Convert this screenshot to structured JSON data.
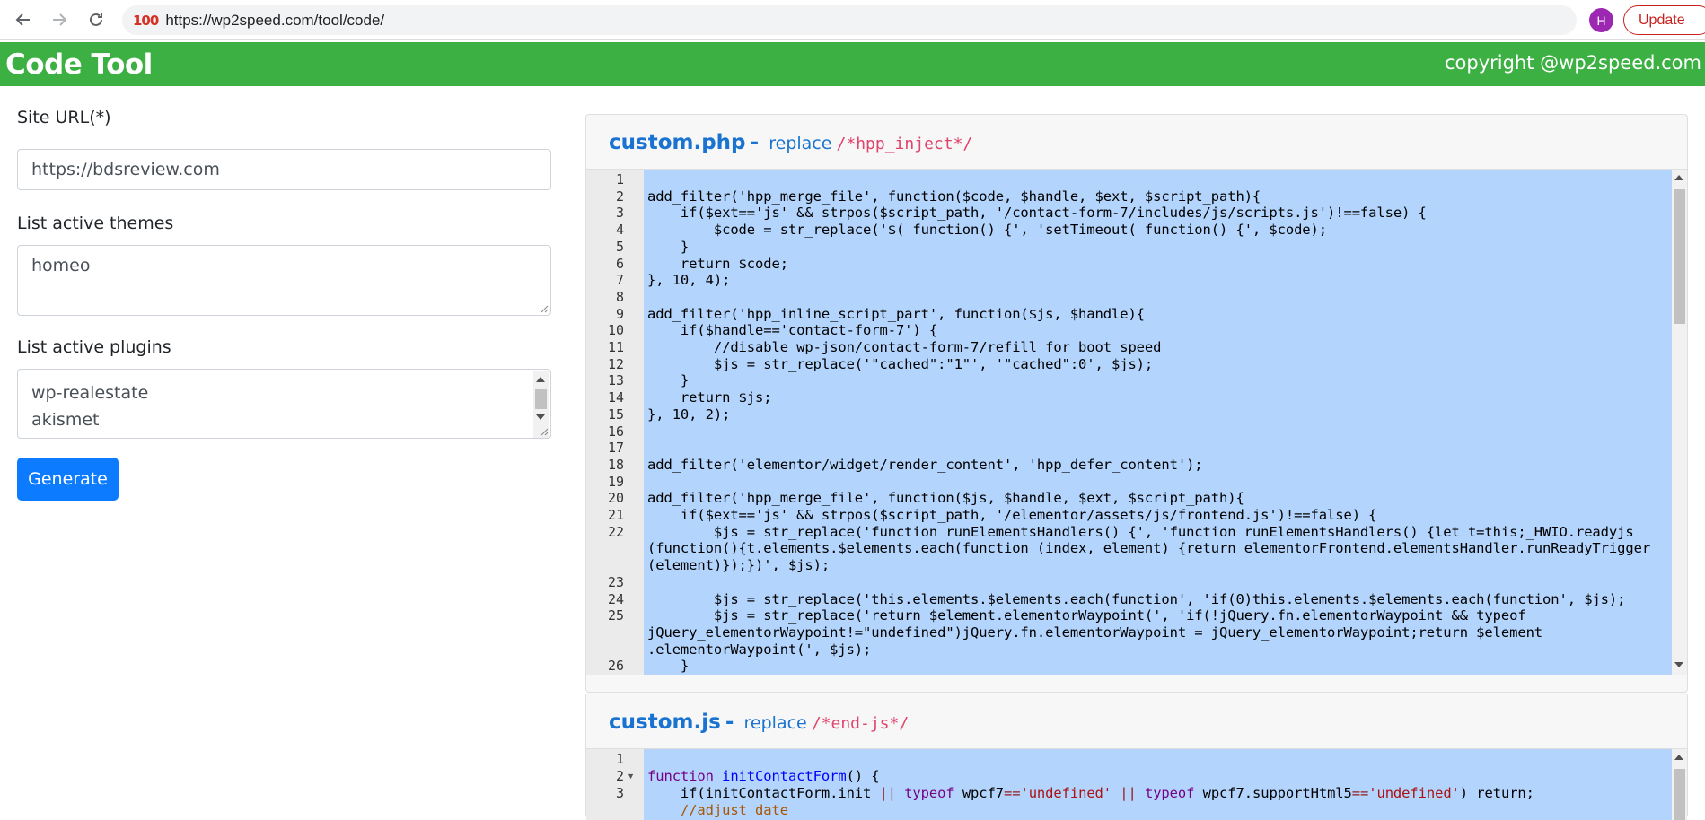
{
  "browser": {
    "url": "https://wp2speed.com/tool/code/",
    "profile_initial": "H",
    "update_label": "Update"
  },
  "header": {
    "title": "Code Tool",
    "copyright": "copyright @wp2speed.com"
  },
  "form": {
    "site_url_label": "Site URL(*)",
    "site_url_value": "https://bdsreview.com",
    "themes_label": "List active themes",
    "themes_value": "homeo",
    "plugins_label": "List active plugins",
    "plugins_line1": "wp-realestate",
    "plugins_line2": "akismet",
    "generate_label": "Generate"
  },
  "php_card": {
    "filename": "custom.php",
    "dash": "-",
    "replace_label": "replace",
    "marker": "/*hpp_inject*/",
    "line_numbers": [
      "1",
      "2",
      "3",
      "4",
      "5",
      "6",
      "7",
      "8",
      "9",
      "10",
      "11",
      "12",
      "13",
      "14",
      "15",
      "16",
      "17",
      "18",
      "19",
      "20",
      "21",
      "22",
      "23",
      "24",
      "25",
      "26"
    ],
    "lines": [
      "",
      "add_filter('hpp_merge_file', function($code, $handle, $ext, $script_path){",
      "    if($ext=='js' && strpos($script_path, '/contact-form-7/includes/js/scripts.js')!==false) {",
      "        $code = str_replace('$( function() {', 'setTimeout( function() {', $code);",
      "    }",
      "    return $code;",
      "}, 10, 4);",
      "",
      "add_filter('hpp_inline_script_part', function($js, $handle){",
      "    if($handle=='contact-form-7') {",
      "        //disable wp-json/contact-form-7/refill for boot speed",
      "        $js = str_replace('\"cached\":\"1\"', '\"cached\":0', $js);",
      "    }",
      "    return $js;",
      "}, 10, 2);",
      "",
      "",
      "add_filter('elementor/widget/render_content', 'hpp_defer_content');",
      "",
      "add_filter('hpp_merge_file', function($js, $handle, $ext, $script_path){",
      "    if($ext=='js' && strpos($script_path, '/elementor/assets/js/frontend.js')!==false) {",
      "        $js = str_replace('function runElementsHandlers() {', 'function runElementsHandlers() {let t=this;_HWIO.readyjs",
      "(function(){t.elements.$elements.each(function (index, element) {return elementorFrontend.elementsHandler.runReadyTrigger",
      "(element)});})', $js);",
      "",
      "        $js = str_replace('this.elements.$elements.each(function', 'if(0)this.elements.$elements.each(function', $js);",
      "        $js = str_replace('return $element.elementorWaypoint(', 'if(!jQuery.fn.elementorWaypoint && typeof",
      "jQuery_elementorWaypoint!=\"undefined\")jQuery.fn.elementorWaypoint = jQuery_elementorWaypoint;return $element",
      ".elementorWaypoint(', $js);",
      "    }"
    ]
  },
  "js_card": {
    "filename": "custom.js",
    "dash": "-",
    "replace_label": "replace",
    "marker": "/*end-js*/",
    "line_numbers": [
      "1",
      "2",
      "3"
    ],
    "l2_kw": "function",
    "l2_fn": "initContactForm",
    "l2_rest": "() {",
    "l3_a": "    if(initContactForm.init ",
    "l3_op1": "||",
    "l3_kw1": " typeof",
    "l3_b": " wpcf7",
    "l3_op2": "==",
    "l3_s1": "'undefined'",
    "l3_op3": " ||",
    "l3_kw2": " typeof",
    "l3_c": " wpcf7.supportHtml5",
    "l3_op4": "==",
    "l3_s2": "'undefined'",
    "l3_d": ") return;",
    "l4_cm": "    //adjust date"
  }
}
